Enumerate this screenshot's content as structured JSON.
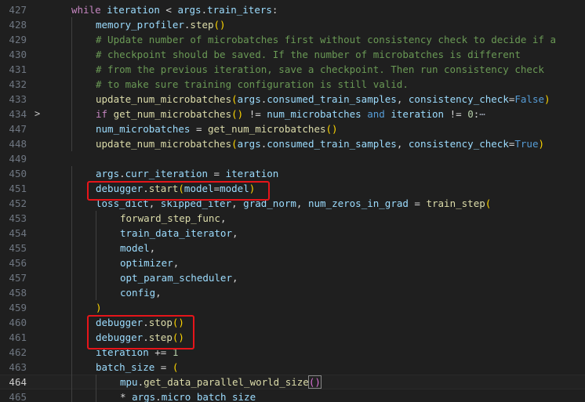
{
  "editor": {
    "lines": [
      {
        "n": "427",
        "tokens": [
          [
            "kw",
            "while"
          ],
          [
            "v",
            " iteration"
          ],
          [
            "op",
            " < "
          ],
          [
            "v",
            "args"
          ],
          [
            "op",
            "."
          ],
          [
            "v",
            "train_iters"
          ],
          [
            "op",
            ":"
          ]
        ]
      },
      {
        "n": "428",
        "tokens": [
          [
            "v",
            "memory_profiler"
          ],
          [
            "op",
            "."
          ],
          [
            "fn",
            "step"
          ],
          [
            "b1",
            "()"
          ]
        ]
      },
      {
        "n": "429",
        "tokens": [
          [
            "cm",
            "# Update number of microbatches first without consistency check to decide if a"
          ]
        ]
      },
      {
        "n": "430",
        "tokens": [
          [
            "cm",
            "# checkpoint should be saved. If the number of microbatches is different"
          ]
        ]
      },
      {
        "n": "431",
        "tokens": [
          [
            "cm",
            "# from the previous iteration, save a checkpoint. Then run consistency check"
          ]
        ]
      },
      {
        "n": "432",
        "tokens": [
          [
            "cm",
            "# to make sure training configuration is still valid."
          ]
        ]
      },
      {
        "n": "433",
        "tokens": [
          [
            "fn",
            "update_num_microbatches"
          ],
          [
            "b1",
            "("
          ],
          [
            "v",
            "args"
          ],
          [
            "op",
            "."
          ],
          [
            "v",
            "consumed_train_samples"
          ],
          [
            "op",
            ", "
          ],
          [
            "par",
            "consistency_check"
          ],
          [
            "op",
            "="
          ],
          [
            "bl",
            "False"
          ],
          [
            "b1",
            ")"
          ]
        ]
      },
      {
        "n": "434",
        "fold": ">",
        "tokens": [
          [
            "kw",
            "if"
          ],
          [
            "fn",
            " get_num_microbatches"
          ],
          [
            "b1",
            "()"
          ],
          [
            "op",
            " != "
          ],
          [
            "v",
            "num_microbatches"
          ],
          [
            "bl",
            " and"
          ],
          [
            "v",
            " iteration"
          ],
          [
            "op",
            " != "
          ],
          [
            "num",
            "0"
          ],
          [
            "op",
            ":"
          ],
          [
            "dots",
            "⋯"
          ]
        ]
      },
      {
        "n": "447",
        "tokens": [
          [
            "v",
            "num_microbatches"
          ],
          [
            "op",
            " = "
          ],
          [
            "fn",
            "get_num_microbatches"
          ],
          [
            "b1",
            "()"
          ]
        ]
      },
      {
        "n": "448",
        "tokens": [
          [
            "fn",
            "update_num_microbatches"
          ],
          [
            "b1",
            "("
          ],
          [
            "v",
            "args"
          ],
          [
            "op",
            "."
          ],
          [
            "v",
            "consumed_train_samples"
          ],
          [
            "op",
            ", "
          ],
          [
            "par",
            "consistency_check"
          ],
          [
            "op",
            "="
          ],
          [
            "bl",
            "True"
          ],
          [
            "b1",
            ")"
          ]
        ]
      },
      {
        "n": "449",
        "tokens": []
      },
      {
        "n": "450",
        "tokens": [
          [
            "v",
            "args"
          ],
          [
            "op",
            "."
          ],
          [
            "v",
            "curr_iteration"
          ],
          [
            "op",
            " = "
          ],
          [
            "v",
            "iteration"
          ]
        ]
      },
      {
        "n": "451",
        "tokens": [
          [
            "v",
            "debugger"
          ],
          [
            "op",
            "."
          ],
          [
            "fn",
            "start"
          ],
          [
            "b1",
            "("
          ],
          [
            "par",
            "model"
          ],
          [
            "op",
            "="
          ],
          [
            "v",
            "model"
          ],
          [
            "b1",
            ")"
          ]
        ]
      },
      {
        "n": "452",
        "tokens": [
          [
            "v",
            "loss_dict"
          ],
          [
            "op",
            ", "
          ],
          [
            "v",
            "skipped_iter"
          ],
          [
            "op",
            ", "
          ],
          [
            "v",
            "grad_norm"
          ],
          [
            "op",
            ", "
          ],
          [
            "v",
            "num_zeros_in_grad"
          ],
          [
            "op",
            " = "
          ],
          [
            "fn",
            "train_step"
          ],
          [
            "b1",
            "("
          ]
        ]
      },
      {
        "n": "453",
        "tokens": [
          [
            "fn",
            "forward_step_func"
          ],
          [
            "op",
            ","
          ]
        ]
      },
      {
        "n": "454",
        "tokens": [
          [
            "v",
            "train_data_iterator"
          ],
          [
            "op",
            ","
          ]
        ]
      },
      {
        "n": "455",
        "tokens": [
          [
            "v",
            "model"
          ],
          [
            "op",
            ","
          ]
        ]
      },
      {
        "n": "456",
        "tokens": [
          [
            "v",
            "optimizer"
          ],
          [
            "op",
            ","
          ]
        ]
      },
      {
        "n": "457",
        "tokens": [
          [
            "v",
            "opt_param_scheduler"
          ],
          [
            "op",
            ","
          ]
        ]
      },
      {
        "n": "458",
        "tokens": [
          [
            "v",
            "config"
          ],
          [
            "op",
            ","
          ]
        ]
      },
      {
        "n": "459",
        "tokens": [
          [
            "b1",
            ")"
          ]
        ]
      },
      {
        "n": "460",
        "tokens": [
          [
            "v",
            "debugger"
          ],
          [
            "op",
            "."
          ],
          [
            "fn",
            "stop"
          ],
          [
            "b1",
            "()"
          ]
        ]
      },
      {
        "n": "461",
        "tokens": [
          [
            "v",
            "debugger"
          ],
          [
            "op",
            "."
          ],
          [
            "fn",
            "step"
          ],
          [
            "b1",
            "()"
          ]
        ]
      },
      {
        "n": "462",
        "tokens": [
          [
            "v",
            "iteration"
          ],
          [
            "op",
            " += "
          ],
          [
            "num",
            "1"
          ]
        ]
      },
      {
        "n": "463",
        "tokens": [
          [
            "v",
            "batch_size"
          ],
          [
            "op",
            " = "
          ],
          [
            "b1",
            "("
          ]
        ]
      },
      {
        "n": "464",
        "current": true,
        "tokens": [
          [
            "v",
            "mpu"
          ],
          [
            "op",
            "."
          ],
          [
            "fn",
            "get_data_parallel_world_size"
          ],
          [
            "b2",
            "()"
          ]
        ]
      },
      {
        "n": "465",
        "tokens": [
          [
            "op",
            "* "
          ],
          [
            "v",
            "args"
          ],
          [
            "op",
            "."
          ],
          [
            "v",
            "micro_batch_size"
          ]
        ]
      }
    ]
  }
}
